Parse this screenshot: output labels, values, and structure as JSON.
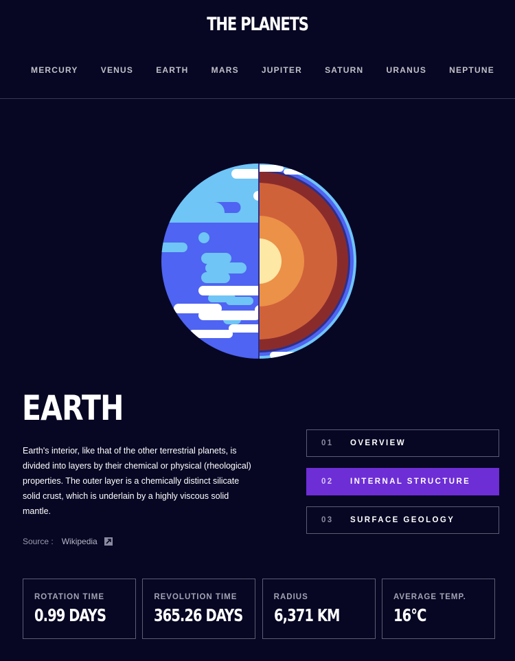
{
  "app": {
    "title": "THE PLANETS"
  },
  "nav": {
    "items": [
      {
        "label": "MERCURY"
      },
      {
        "label": "VENUS"
      },
      {
        "label": "EARTH"
      },
      {
        "label": "MARS"
      },
      {
        "label": "JUPITER"
      },
      {
        "label": "SATURN"
      },
      {
        "label": "URANUS"
      },
      {
        "label": "NEPTUNE"
      }
    ]
  },
  "planet": {
    "name": "EARTH",
    "image_icon": "earth-internal-structure-illustration",
    "description": "Earth's interior, like that of the other terrestrial planets, is divided into layers by their chemical or physical (rheological) properties. The outer layer is a chemically distinct silicate solid crust, which is underlain by a highly viscous solid mantle.",
    "source_label": "Source :",
    "source_link": "Wikipedia",
    "source_icon": "external-link-icon"
  },
  "tabs": [
    {
      "num": "01",
      "label": "OVERVIEW",
      "active": false
    },
    {
      "num": "02",
      "label": "INTERNAL STRUCTURE",
      "active": true
    },
    {
      "num": "03",
      "label": "SURFACE GEOLOGY",
      "active": false
    }
  ],
  "stats": [
    {
      "label": "ROTATION TIME",
      "value": "0.99 DAYS"
    },
    {
      "label": "REVOLUTION TIME",
      "value": "365.26 DAYS"
    },
    {
      "label": "RADIUS",
      "value": "6,371 KM"
    },
    {
      "label": "AVERAGE TEMP.",
      "value": "16°C"
    }
  ],
  "colors": {
    "background": "#070724",
    "accent": "#6d2ed5",
    "border": "#5d5d73"
  }
}
